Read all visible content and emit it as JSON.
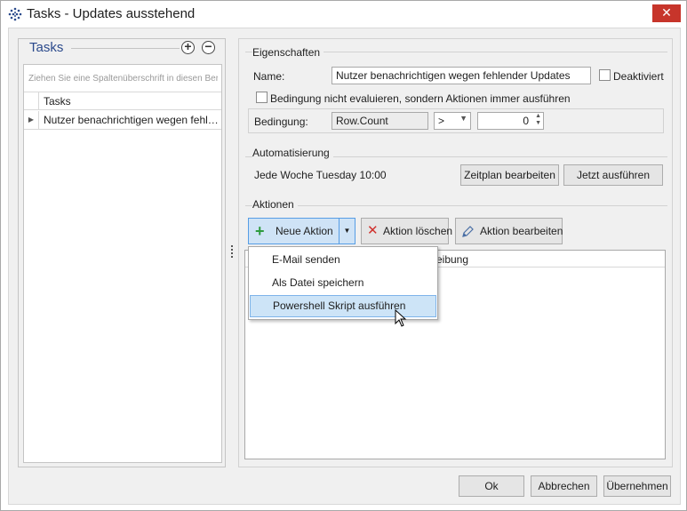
{
  "window": {
    "title": "Tasks - Updates ausstehend",
    "close_label": "✕"
  },
  "tasks_panel": {
    "title": "Tasks",
    "add_label": "+",
    "remove_label": "−",
    "group_hint": "Ziehen Sie eine Spaltenüberschrift in diesen Bereich, um nach dieser Spalte zu gruppieren",
    "column_header": "Tasks",
    "rows": [
      {
        "label": "Nutzer benachrichtigen wegen fehlender Updates"
      }
    ]
  },
  "eigenschaften": {
    "title": "Eigenschaften",
    "name_label": "Name:",
    "name_value": "Nutzer benachrichtigen wegen fehlender Updates",
    "deaktiviert_label": "Deaktiviert",
    "bedingung_checkbox_label": "Bedingung nicht evaluieren, sondern Aktionen immer ausführen",
    "bedingung_label": "Bedingung:",
    "bedingung_field": "Row.Count",
    "operator": ">",
    "value": "0"
  },
  "automatisierung": {
    "title": "Automatisierung",
    "schedule_text": "Jede Woche Tuesday 10:00",
    "zeitplan_button": "Zeitplan bearbeiten",
    "jetzt_button": "Jetzt ausführen"
  },
  "aktionen": {
    "title": "Aktionen",
    "neue_aktion_button": "Neue Aktion",
    "loeschen_button": "Aktion löschen",
    "bearbeiten_button": "Aktion bearbeiten",
    "column_header_fragment": "reibung",
    "dropdown_items": [
      {
        "label": "E-Mail senden"
      },
      {
        "label": "Als Datei speichern"
      },
      {
        "label": "Powershell Skript ausführen"
      }
    ]
  },
  "footer": {
    "ok": "Ok",
    "abbrechen": "Abbrechen",
    "uebernehmen": "Übernehmen"
  },
  "colors": {
    "accent_title": "#2b4a8c",
    "close_red": "#c7352b",
    "highlight": "#cde4f7",
    "add_green": "#2e9b3e",
    "delete_red": "#d0312d"
  }
}
